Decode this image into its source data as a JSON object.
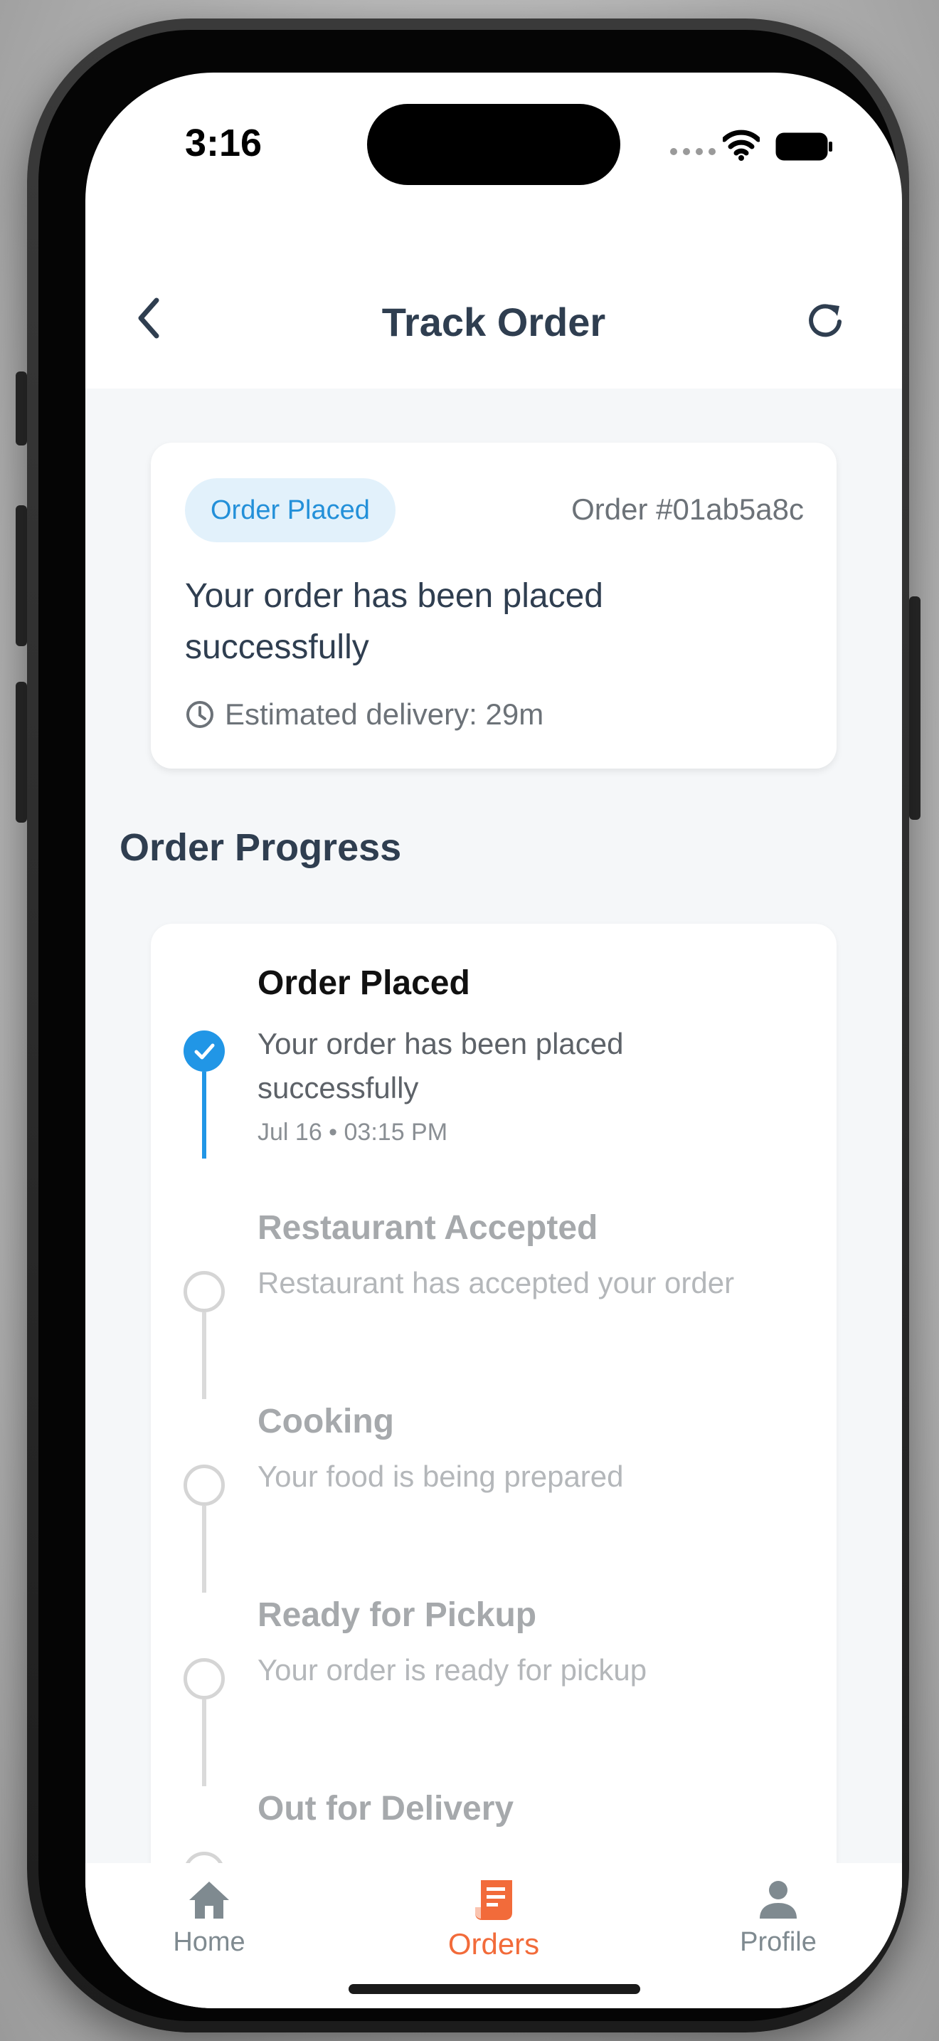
{
  "status_bar": {
    "time": "3:16"
  },
  "header": {
    "title": "Track Order",
    "back_icon": "chevron-left-icon",
    "refresh_icon": "refresh-icon"
  },
  "order_summary": {
    "status_badge": "Order Placed",
    "order_number": "Order #01ab5a8c",
    "message": "Your order has been placed successfully",
    "eta": "Estimated delivery: 29m",
    "eta_icon": "clock-icon"
  },
  "progress": {
    "section_title": "Order Progress",
    "steps": [
      {
        "title": "Order Placed",
        "description": "Your order has been placed successfully",
        "time": "Jul 16 • 03:15 PM",
        "completed": true
      },
      {
        "title": "Restaurant Accepted",
        "description": "Restaurant has accepted your order",
        "completed": false
      },
      {
        "title": "Cooking",
        "description": "Your food is being prepared",
        "completed": false
      },
      {
        "title": "Ready for Pickup",
        "description": "Your order is ready for pickup",
        "completed": false
      },
      {
        "title": "Out for Delivery",
        "completed": false
      }
    ]
  },
  "bottom_nav": {
    "items": [
      {
        "label": "Home",
        "icon": "home-icon",
        "active": false
      },
      {
        "label": "Orders",
        "icon": "receipt-icon",
        "active": true
      },
      {
        "label": "Profile",
        "icon": "person-icon",
        "active": false
      }
    ]
  },
  "colors": {
    "accent_blue": "#2196e6",
    "accent_orange": "#f26b3a",
    "text_dark": "#2f3e50",
    "background": "#f5f7f9"
  }
}
